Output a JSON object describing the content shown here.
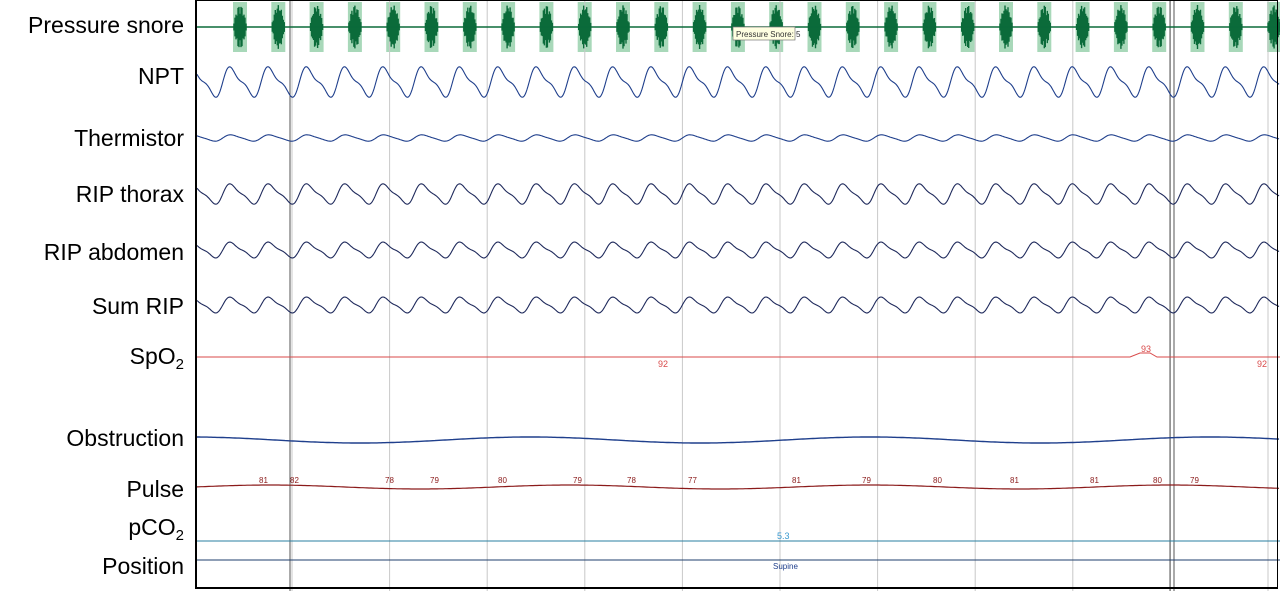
{
  "channels": [
    {
      "key": "snore",
      "label": "Pressure snore",
      "sub": "",
      "color": "#0b6b3a"
    },
    {
      "key": "npt",
      "label": "NPT",
      "sub": "",
      "color": "#1f3f8c"
    },
    {
      "key": "thermistor",
      "label": "Thermistor",
      "sub": "",
      "color": "#1f3f8c"
    },
    {
      "key": "rip_thorax",
      "label": "RIP thorax",
      "sub": "",
      "color": "#1f2a5c"
    },
    {
      "key": "rip_abdomen",
      "label": "RIP abdomen",
      "sub": "",
      "color": "#1f2a5c"
    },
    {
      "key": "sum_rip",
      "label": "Sum RIP",
      "sub": "",
      "color": "#1f2a5c"
    },
    {
      "key": "spo2",
      "label": "SpO",
      "sub": "2",
      "color": "#d94a4a"
    },
    {
      "key": "obstruction",
      "label": "Obstruction",
      "sub": "",
      "color": "#1f3f8c"
    },
    {
      "key": "pulse",
      "label": "Pulse",
      "sub": "",
      "color": "#8b1a1a"
    },
    {
      "key": "pco2",
      "label": "pCO",
      "sub": "2",
      "color": "#2a7fa0"
    },
    {
      "key": "position",
      "label": "Position",
      "sub": "",
      "color": "#1f3f6c"
    }
  ],
  "snore_tooltip": "Pressure Snore: 5",
  "spo2_values": {
    "left": "92",
    "peak": "93",
    "right": "92"
  },
  "pulse_values": [
    "81",
    "82",
    "78",
    "79",
    "80",
    "79",
    "78",
    "77",
    "81",
    "79",
    "80",
    "81",
    "81",
    "80",
    "79"
  ],
  "pco2_value": "5.3",
  "position_value": "Supine",
  "colors": {
    "snore_highlight": "#a8d8b9",
    "grid": "#c8c8c8",
    "cursor": "#555555"
  }
}
